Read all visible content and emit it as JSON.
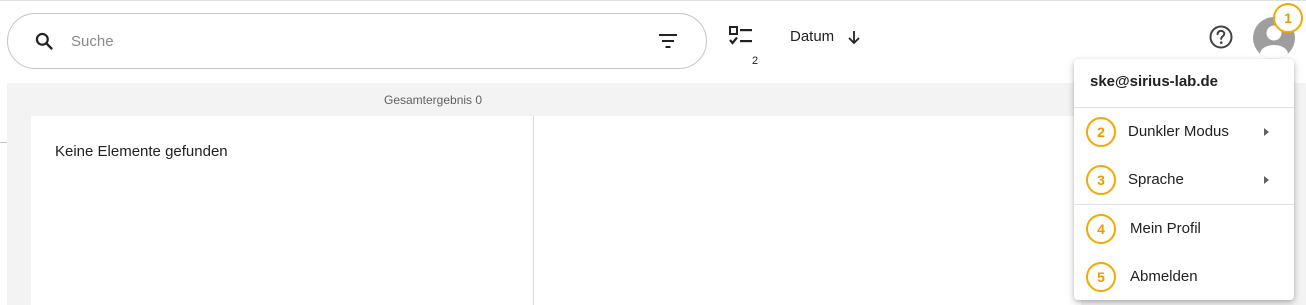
{
  "search": {
    "placeholder": "Suche",
    "value": ""
  },
  "toolbar": {
    "checklist_count": "2",
    "sort_label": "Datum"
  },
  "results": {
    "total_label": "Gesamtergebnis 0",
    "empty_message": "Keine Elemente gefunden"
  },
  "user_menu": {
    "email": "ske@sirius-lab.de",
    "items": [
      {
        "label": "Dunkler Modus",
        "badge": "2",
        "has_submenu": true
      },
      {
        "label": "Sprache",
        "badge": "3",
        "has_submenu": true
      },
      {
        "label": "Mein Profil",
        "badge": "4",
        "has_submenu": false
      },
      {
        "label": "Abmelden",
        "badge": "5",
        "has_submenu": false
      }
    ]
  },
  "annotations": {
    "avatar_badge": "1"
  },
  "colors": {
    "badge_accent": "#f2a900",
    "avatar_gray": "#9e9e9e",
    "content_background": "#f3f3f3"
  },
  "icons": [
    "search-icon",
    "filter-icon",
    "checklist-icon",
    "arrow-down-icon",
    "help-icon",
    "account-icon",
    "caret-right-icon"
  ]
}
